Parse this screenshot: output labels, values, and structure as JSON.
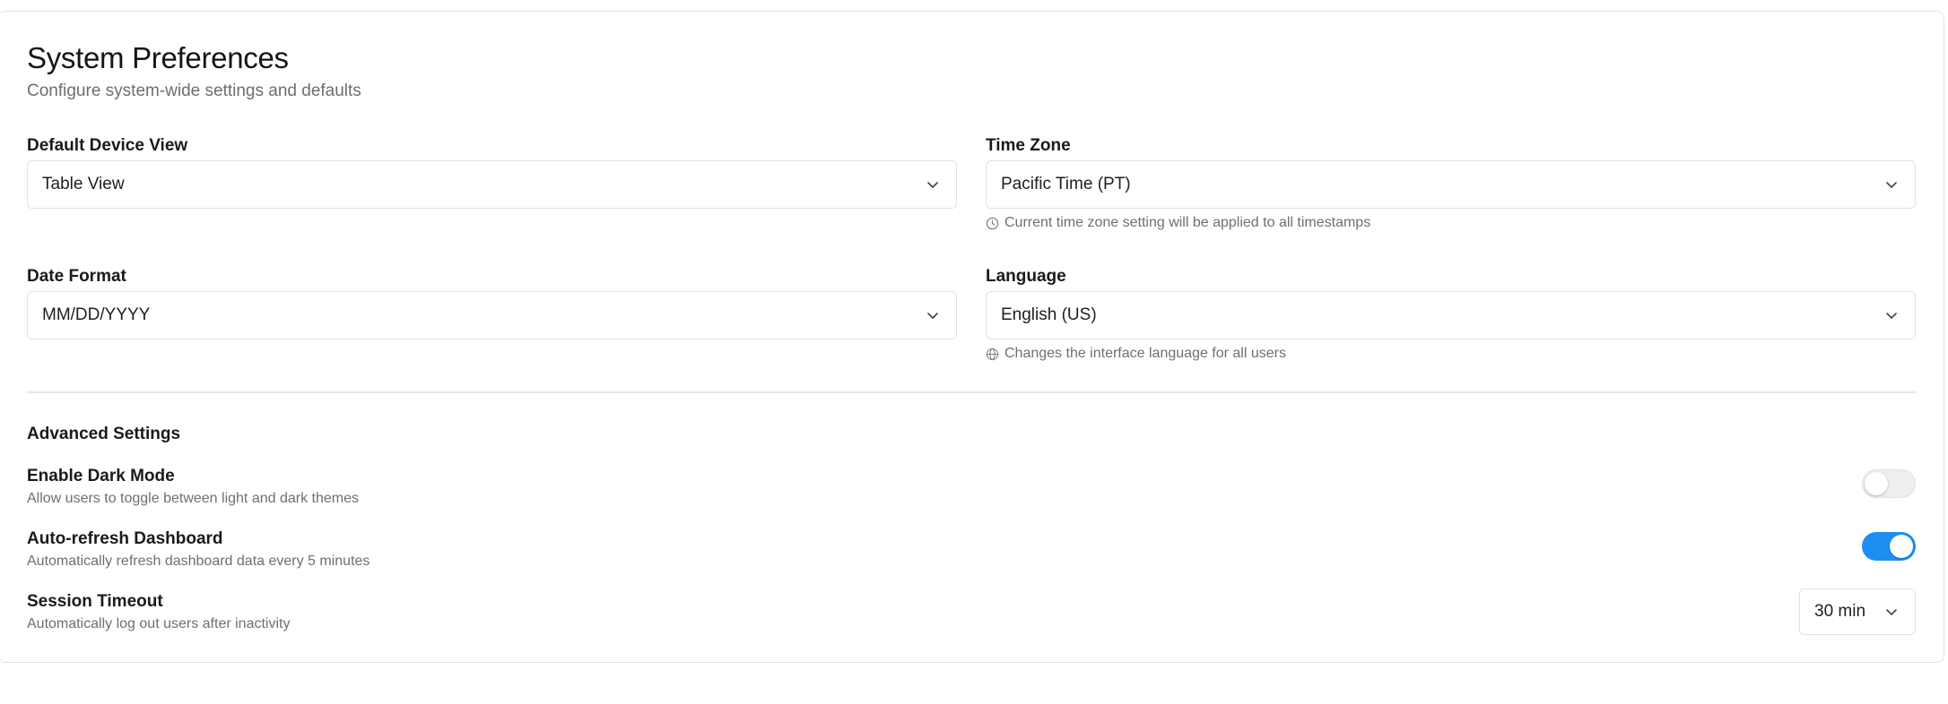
{
  "header": {
    "title": "System Preferences",
    "subtitle": "Configure system-wide settings and defaults"
  },
  "fields": {
    "device_view": {
      "label": "Default Device View",
      "value": "Table View"
    },
    "time_zone": {
      "label": "Time Zone",
      "value": "Pacific Time (PT)",
      "hint": "Current time zone setting will be applied to all timestamps",
      "hint_icon": "clock-icon"
    },
    "date_format": {
      "label": "Date Format",
      "value": "MM/DD/YYYY"
    },
    "language": {
      "label": "Language",
      "value": "English (US)",
      "hint": "Changes the interface language for all users",
      "hint_icon": "globe-icon"
    }
  },
  "advanced": {
    "title": "Advanced Settings",
    "dark_mode": {
      "title": "Enable Dark Mode",
      "description": "Allow users to toggle between light and dark themes",
      "enabled": false
    },
    "auto_refresh": {
      "title": "Auto-refresh Dashboard",
      "description": "Automatically refresh dashboard data every 5 minutes",
      "enabled": true
    },
    "session_timeout": {
      "title": "Session Timeout",
      "description": "Automatically log out users after inactivity",
      "value": "30 min"
    }
  },
  "colors": {
    "accent": "#1f8ef1",
    "border": "#e1e1e1",
    "muted_text": "#6f6f6f"
  }
}
